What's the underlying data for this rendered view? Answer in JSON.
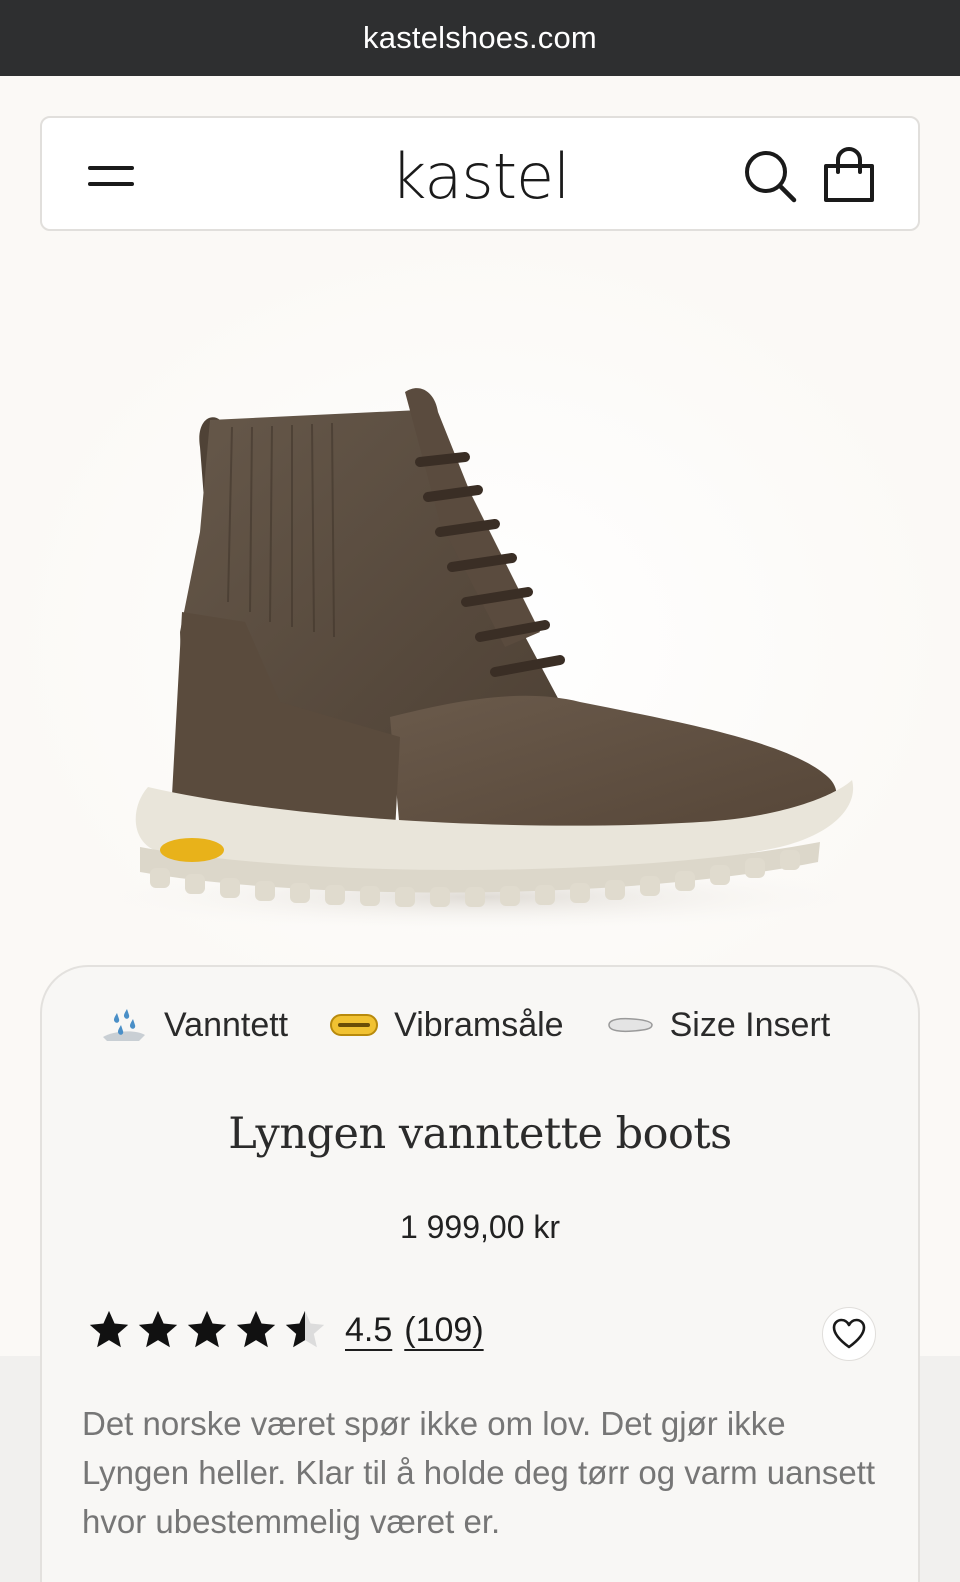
{
  "browser": {
    "url": "kastelshoes.com"
  },
  "header": {
    "logo": "kastel",
    "menu_icon": "hamburger-menu-icon",
    "search_icon": "search-icon",
    "bag_icon": "shopping-bag-icon"
  },
  "product": {
    "image_alt": "brown knit high-top boot with white Vibram sole",
    "features": [
      {
        "icon": "water-drops-icon",
        "label": "Vanntett"
      },
      {
        "icon": "vibram-logo-icon",
        "label": "Vibramsåle"
      },
      {
        "icon": "insole-icon",
        "label": "Size Insert"
      }
    ],
    "title": "Lyngen vanntette boots",
    "price": "1 999,00 kr",
    "rating": {
      "stars": 4.5,
      "value": "4.5",
      "count": "(109)"
    },
    "description": "Det norske været spør ikke om lov. Det gjør ikke Lyngen heller. Klar til å holde deg tørr og varm uansett hvor ubestemmelig været er."
  },
  "colors": {
    "topbar": "#2e2f30",
    "boot_upper": "#5b4d3f",
    "sole": "#e6e2d6",
    "vibram_yellow": "#e8b21a"
  }
}
